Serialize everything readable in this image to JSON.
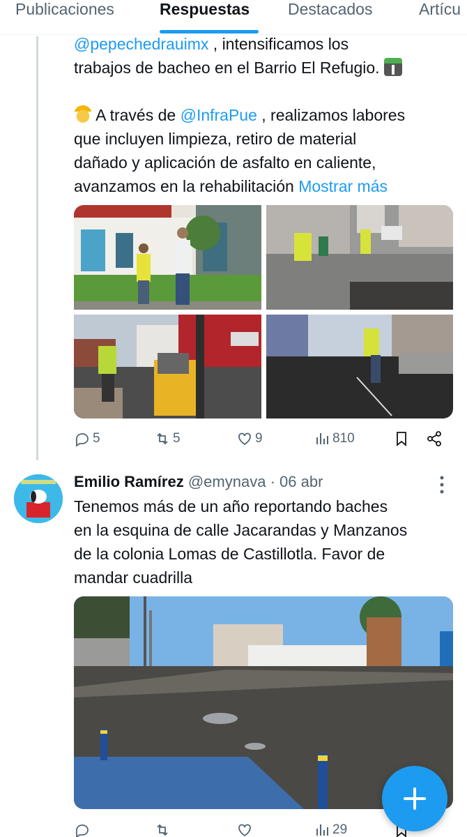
{
  "tabs": [
    {
      "label": "Publicaciones"
    },
    {
      "label": "Respuestas"
    },
    {
      "label": "Destacados"
    },
    {
      "label": "Artícu"
    }
  ],
  "post1": {
    "mention1": "@pepechedrauimx",
    "line1_rest": " , intensificamos los",
    "line2": "trabajos de bacheo en el Barrio El Refugio. ",
    "line3_pre": " A través de ",
    "mention2": "@InfraPue",
    "line3_rest": " , realizamos labores",
    "line4": "que incluyen limpieza, retiro de material",
    "line5": "dañado y aplicación de asfalto en caliente,",
    "line6": "avanzamos en la rehabilitación ",
    "show_more": "Mostrar más",
    "stats": {
      "replies": "5",
      "reposts": "5",
      "likes": "9",
      "views": "810"
    }
  },
  "post2": {
    "name": "Emilio Ramírez",
    "handle": "@emynava",
    "dot": " · ",
    "date": "06 abr",
    "lines": [
      "Tenemos más de un año reportando baches",
      "en la esquina de calle Jacarandas y Manzanos",
      "de la colonia Lomas de Castillotla. Favor de",
      "mandar cuadrilla"
    ],
    "stats": {
      "views": "29"
    }
  },
  "colors": {
    "accent": "#1d9bf0",
    "muted": "#536471",
    "text": "#0f1419"
  }
}
